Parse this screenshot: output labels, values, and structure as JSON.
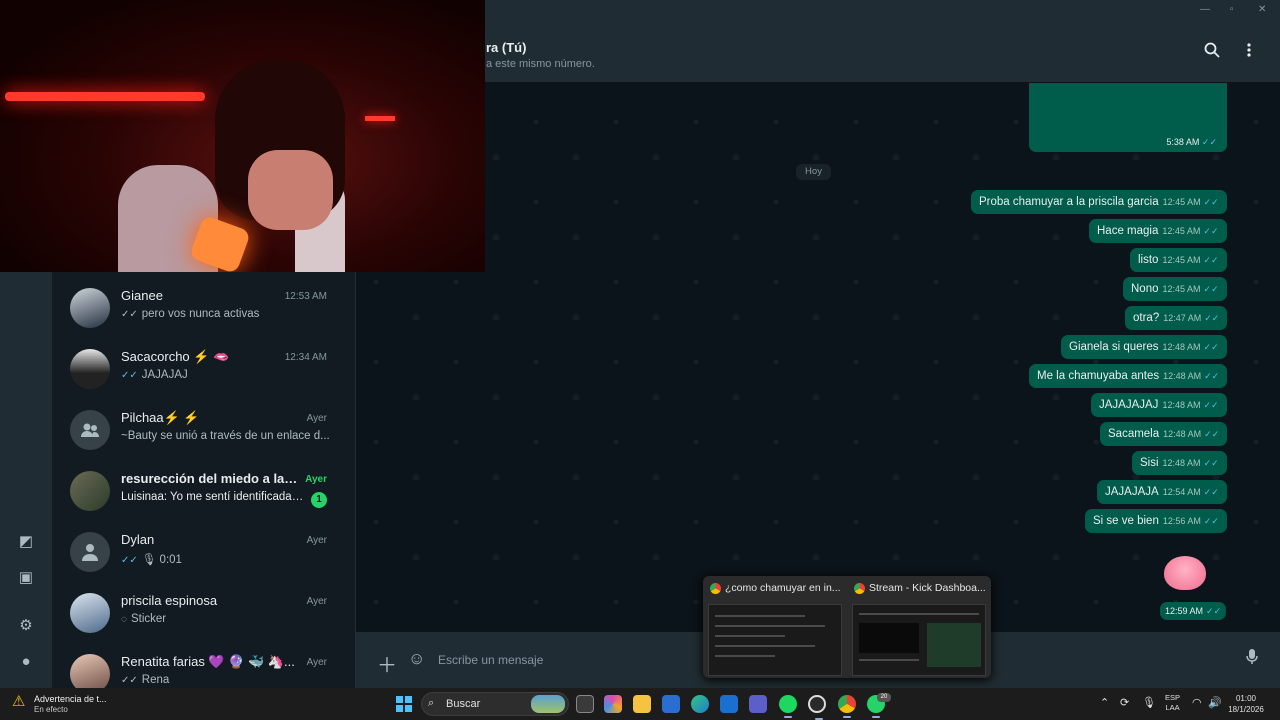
{
  "conversation": {
    "title": "ra (Tú)",
    "subtitle": "a este mismo número.",
    "date_chip": "Hoy",
    "first_bubble_time": "5:38 AM",
    "sticker_time": "12:59 AM",
    "messages": [
      {
        "text": "Proba chamuyar a la priscila garcia",
        "time": "12:45 AM"
      },
      {
        "text": "Hace magia",
        "time": "12:45 AM"
      },
      {
        "text": "listo",
        "time": "12:45 AM"
      },
      {
        "text": "Nono",
        "time": "12:45 AM"
      },
      {
        "text": "otra?",
        "time": "12:47 AM"
      },
      {
        "text": "Gianela si queres",
        "time": "12:48 AM"
      },
      {
        "text": "Me la chamuyaba antes",
        "time": "12:48 AM"
      },
      {
        "text": "JAJAJAJAJ",
        "time": "12:48 AM"
      },
      {
        "text": "Sacamela",
        "time": "12:48 AM"
      },
      {
        "text": "Sisi",
        "time": "12:48 AM"
      },
      {
        "text": "JAJAJAJA",
        "time": "12:54 AM"
      },
      {
        "text": "Si se ve bien",
        "time": "12:56 AM"
      }
    ],
    "composer_placeholder": "Escribe un mensaje"
  },
  "chats": [
    {
      "name": "Gianee",
      "time": "12:53 AM",
      "preview": "pero vos nunca activas",
      "ticks": "✓✓",
      "avatar": "photo"
    },
    {
      "name": "Sacacorcho ⚡ 🫦",
      "time": "12:34 AM",
      "preview": "JAJAJAJ",
      "ticks": "✓✓",
      "avatar": "photo"
    },
    {
      "name": "Pilchaa⚡ ⚡",
      "time": "Ayer",
      "preview": "~Bauty se unió a través de un enlace d...",
      "ticks": "",
      "avatar": "group"
    },
    {
      "name": "resurección del miedo a las p...",
      "time": "Ayer",
      "preview": "Luisinaa: Yo me sentí identificada e...",
      "ticks": "",
      "avatar": "photo",
      "unread": "1"
    },
    {
      "name": "Dylan",
      "time": "Ayer",
      "preview": "🎙 0:01",
      "ticks": "✓✓",
      "avatar": "person"
    },
    {
      "name": "priscila espinosa",
      "time": "Ayer",
      "preview": "Sticker",
      "ticks": "",
      "avatar": "photo"
    },
    {
      "name": "Renatita farias 💜 🔮 🐳 🦄...",
      "time": "Ayer",
      "preview": "Rena",
      "ticks": "✓✓",
      "avatar": "photo"
    }
  ],
  "preview_windows": [
    {
      "title": "¿como chamuyar en in..."
    },
    {
      "title": "Stream - Kick Dashboa..."
    }
  ],
  "taskbar": {
    "notification_title": "Advertencia de t...",
    "notification_status": "En efecto",
    "search_label": "Buscar",
    "lang_top": "ESP",
    "lang_bottom": "LAA",
    "time": "01:00",
    "date": "18/1/2026",
    "badge_count": "20"
  },
  "icons": [
    "search-icon",
    "menu-icon",
    "plus-icon",
    "sticker-icon",
    "mic-icon",
    "status-icon",
    "media-icon",
    "settings-icon",
    "profile-icon",
    "windows-start-icon",
    "warning-icon"
  ],
  "colors": {
    "outgoing_bubble": "#005c4b",
    "unread_green": "#25d366",
    "read_tick": "#53bdeb",
    "app_bg": "#111b21"
  }
}
